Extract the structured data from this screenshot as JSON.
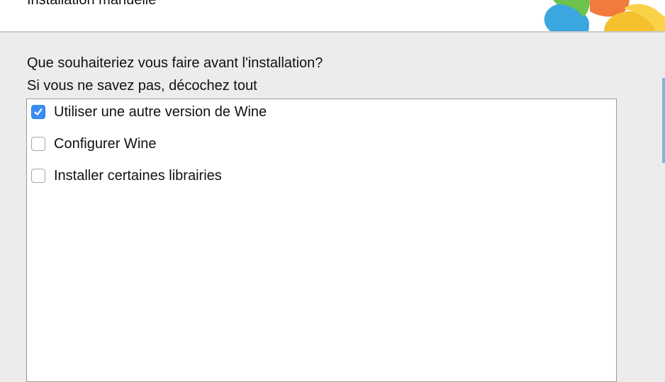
{
  "window": {
    "title": "Installation manuelle"
  },
  "prompt": {
    "line1": "Que souhaiteriez vous faire avant l'installation?",
    "line2": "Si vous ne savez pas, décochez tout"
  },
  "options": [
    {
      "label": "Utiliser une autre version de Wine",
      "checked": true
    },
    {
      "label": "Configurer Wine",
      "checked": false
    },
    {
      "label": "Installer certaines librairies",
      "checked": false
    }
  ],
  "colors": {
    "checkbox_checked": "#3b8cf2",
    "background": "#ececec"
  },
  "logo": {
    "icon": "playonmac-logo-icon"
  }
}
